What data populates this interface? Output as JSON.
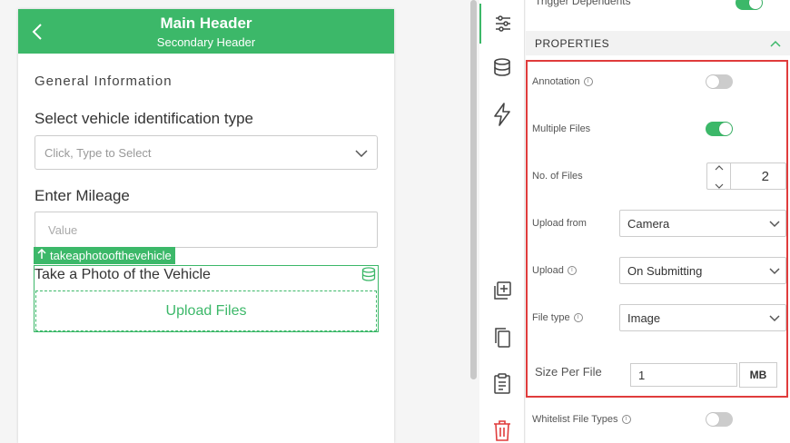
{
  "colors": {
    "accent": "#3cb869",
    "highlight": "#e03c3c"
  },
  "phone": {
    "header_title": "Main Header",
    "header_subtitle": "Secondary Header",
    "section_title": "General Information",
    "vehicle_id_label": "Select vehicle identification type",
    "vehicle_id_placeholder": "Click, Type to Select",
    "mileage_label": "Enter Mileage",
    "mileage_placeholder": "Value",
    "field_tag": "takeaphotoofthevehicle",
    "photo_label": "Take a Photo of the Vehicle",
    "upload_button": "Upload Files"
  },
  "rail": {
    "items": [
      "sliders-icon",
      "database-icon",
      "lightning-icon",
      "add-copy-icon",
      "copy-icon",
      "clipboard-icon",
      "trash-icon"
    ]
  },
  "panel": {
    "top_partial_label": "Trigger Dependents",
    "section_title": "PROPERTIES",
    "annotation_label": "Annotation",
    "annotation_enabled": false,
    "multiple_files_label": "Multiple Files",
    "multiple_files_enabled": true,
    "num_files_label": "No. of Files",
    "num_files_value": "2",
    "upload_from_label": "Upload from",
    "upload_from_value": "Camera",
    "upload_label": "Upload",
    "upload_value": "On Submitting",
    "file_type_label": "File type",
    "file_type_value": "Image",
    "size_label": "Size Per File",
    "size_value": "1",
    "size_unit": "MB",
    "whitelist_label": "Whitelist File Types",
    "whitelist_enabled": false
  }
}
